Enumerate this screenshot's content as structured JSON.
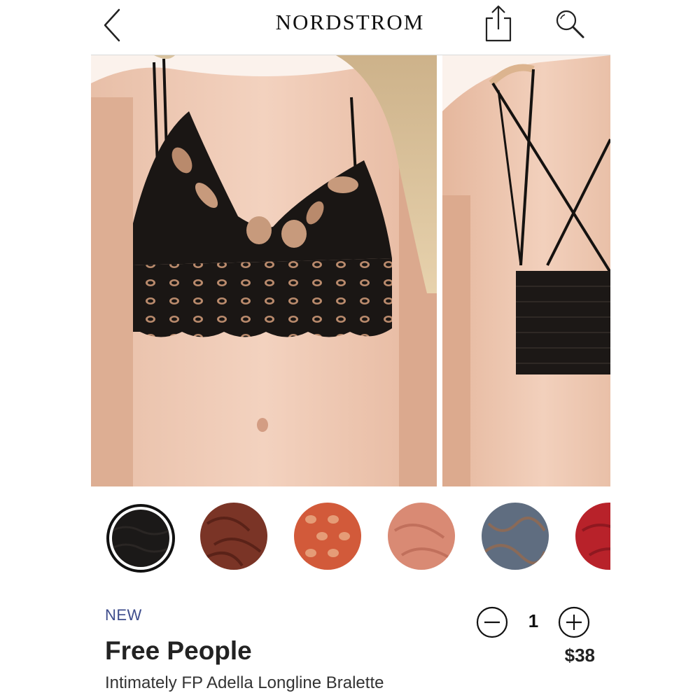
{
  "header": {
    "brand": "NORDSTROM",
    "icons": {
      "back": "chevron-left-icon",
      "share": "share-icon",
      "search": "search-icon"
    }
  },
  "gallery": {
    "images": [
      {
        "view": "front",
        "color": "black"
      },
      {
        "view": "back",
        "color": "black"
      }
    ]
  },
  "swatches": {
    "selected_index": 0,
    "colors": [
      "#1b1918",
      "#7a3426",
      "#d25a3a",
      "#d98a74",
      "#5f6d80",
      "#b8222a"
    ]
  },
  "product": {
    "badge": "NEW",
    "brand": "Free People",
    "name": "Intimately FP Adella Longline Bralette",
    "quantity": "1",
    "price": "$38"
  },
  "colors": {
    "badge": "#3e4d8c",
    "text": "#222222",
    "divider": "#d9d9d9"
  }
}
